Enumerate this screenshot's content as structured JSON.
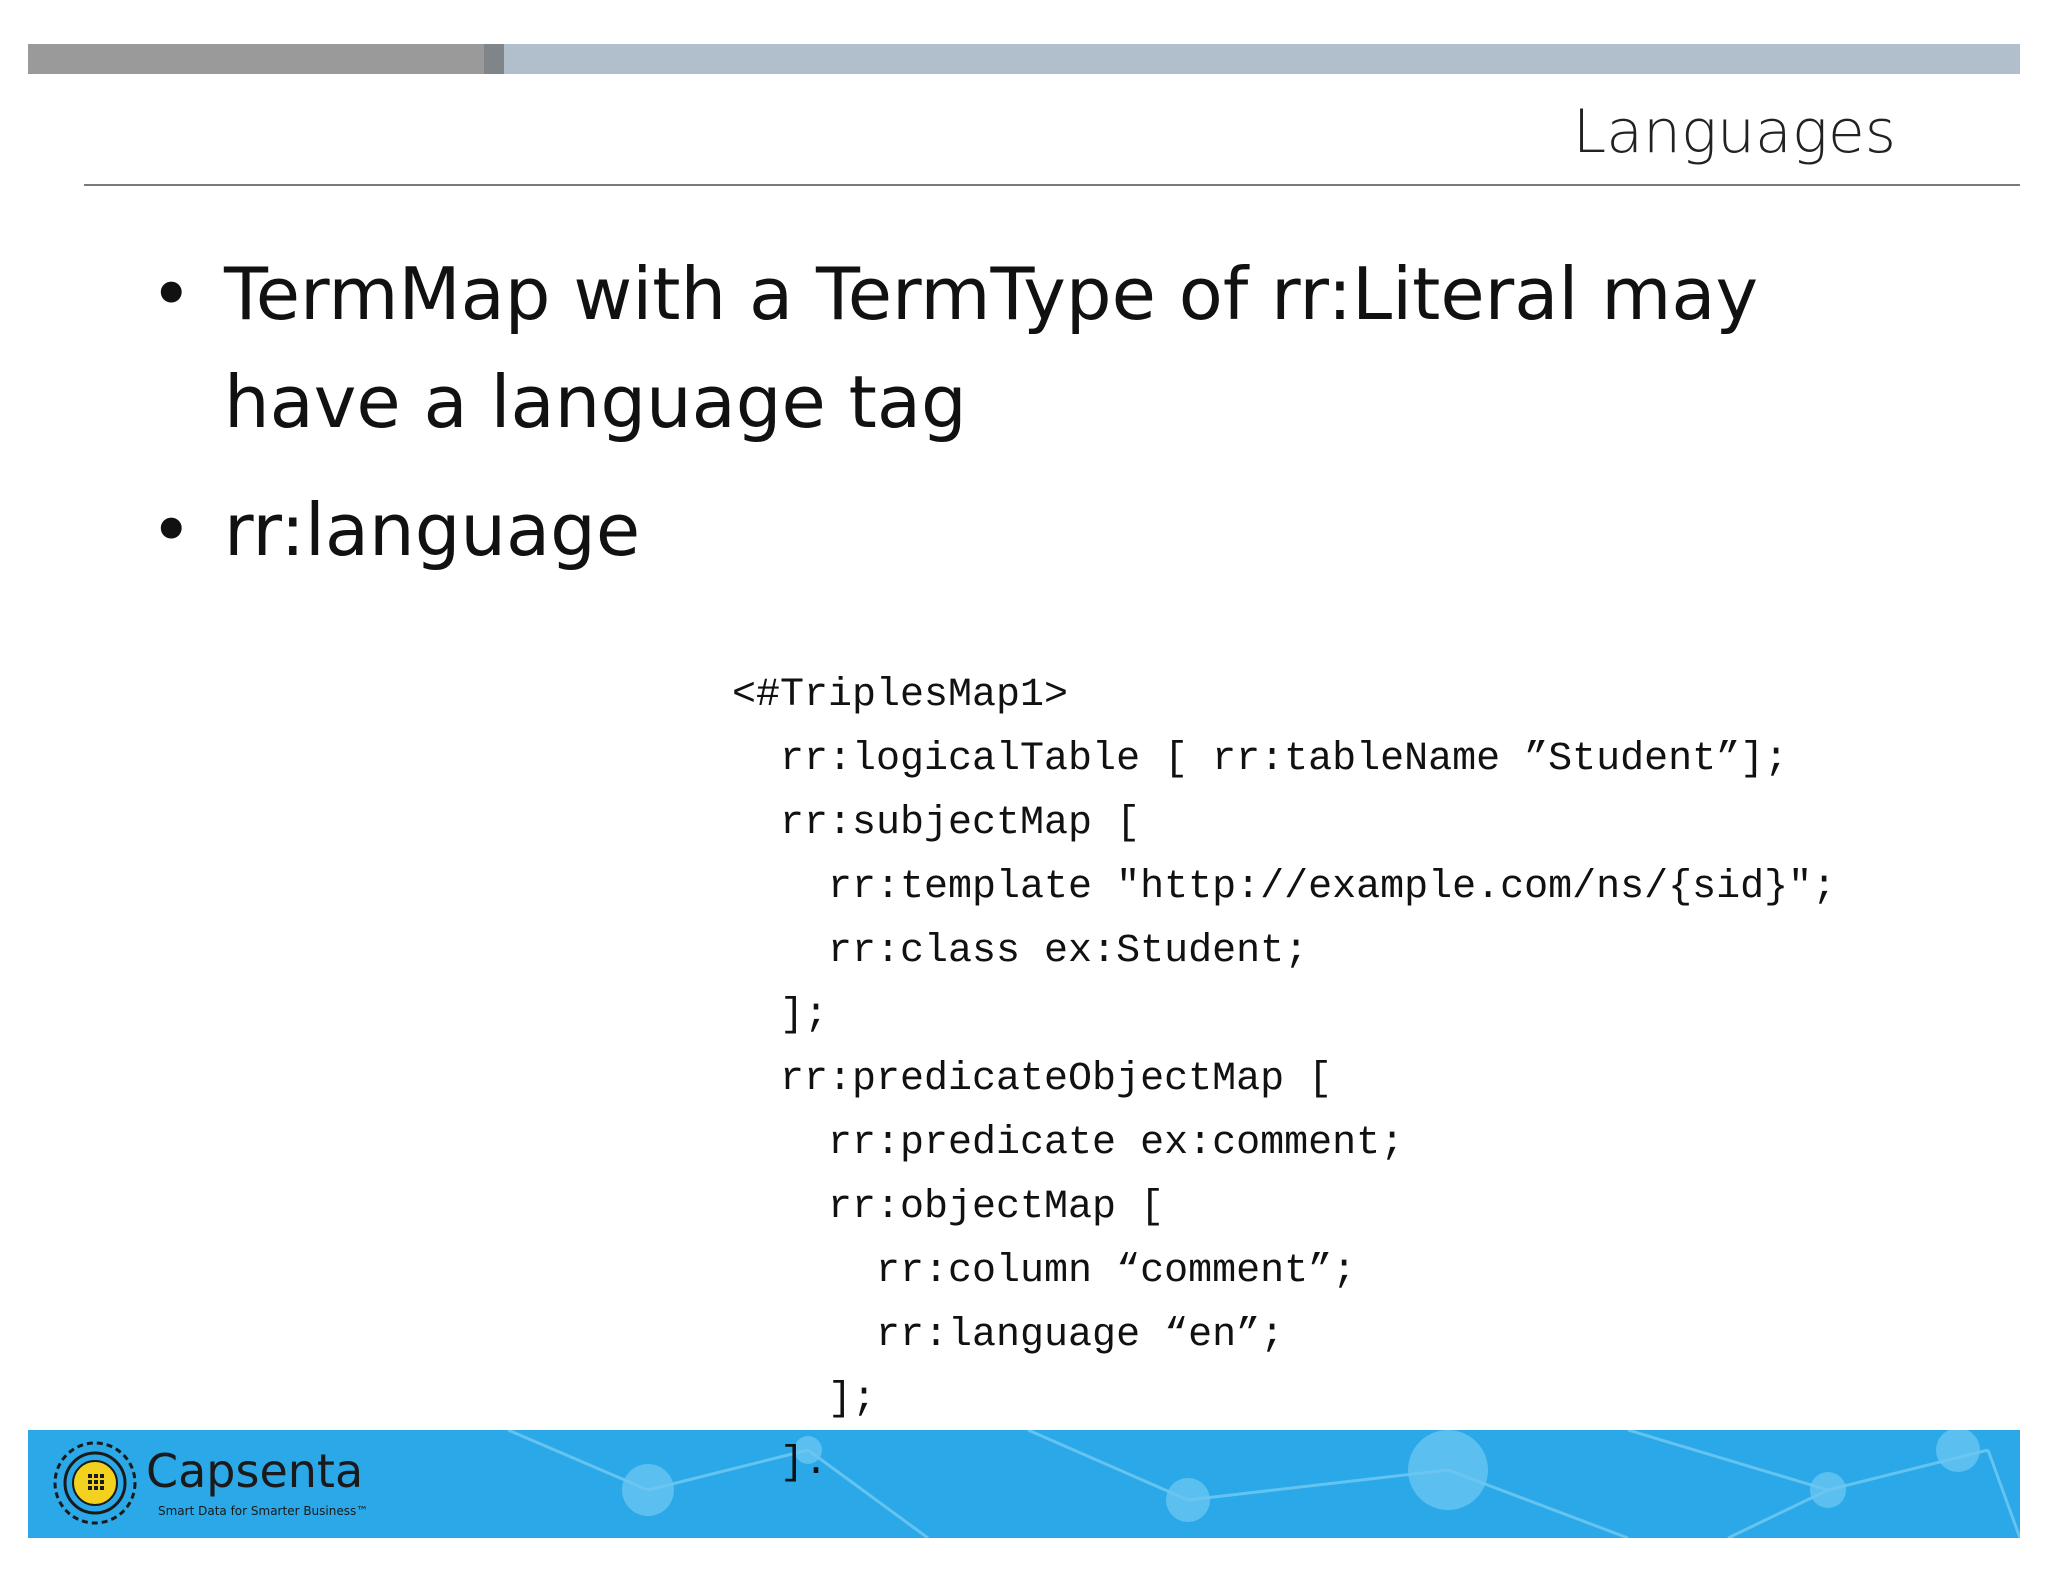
{
  "slide": {
    "title": "Languages",
    "bullets": [
      "TermMap with a TermType of rr:Literal may have a language tag",
      "rr:language"
    ],
    "code_lines": [
      "<#TriplesMap1>",
      "  rr:logicalTable [ rr:tableName ”Student”];",
      "  rr:subjectMap [",
      "    rr:template \"http://example.com/ns/{sid}\";",
      "    rr:class ex:Student;",
      "  ];",
      "  rr:predicateObjectMap [",
      "    rr:predicate ex:comment;",
      "    rr:objectMap [",
      "      rr:column “comment”;",
      "      rr:language “en”;",
      "    ];",
      "  ]."
    ]
  },
  "footer": {
    "brand": "Capsenta",
    "tagline": "Smart Data for Smarter Business™",
    "logo_icon": "capsenta-logo-icon"
  },
  "colors": {
    "top_bar": "#b1bfcd",
    "top_bar_dark": "#9a9a9a",
    "footer": "#2aa8e8"
  }
}
